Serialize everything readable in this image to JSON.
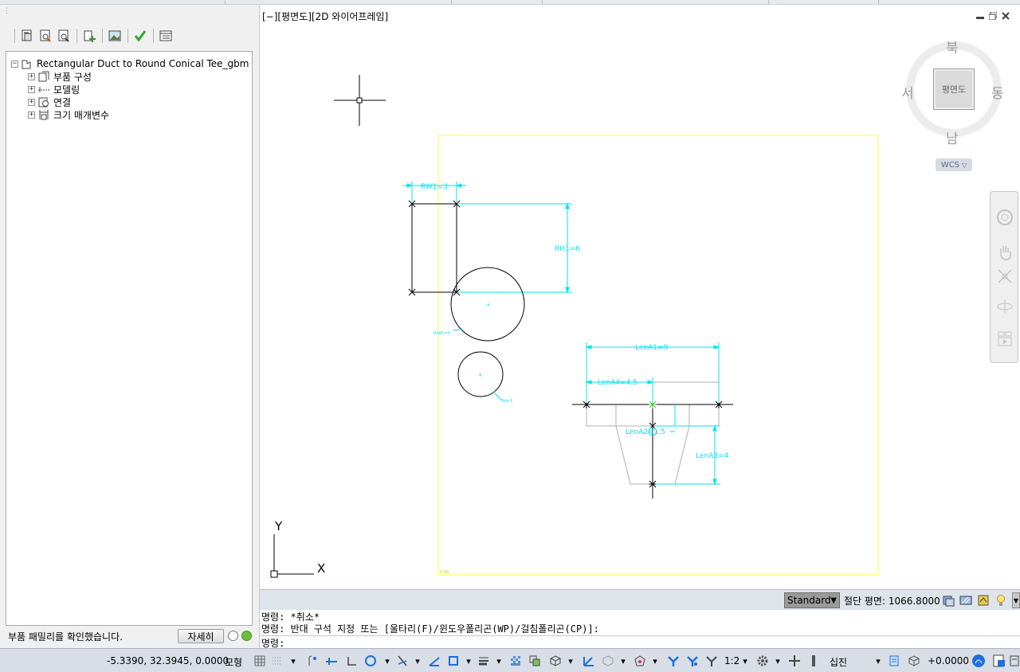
{
  "viewport": {
    "label": "[−][평면도][2D 와이어프레임]",
    "compass": {
      "north": "북",
      "south": "남",
      "east": "동",
      "west": "서"
    },
    "cube_face": "평면도",
    "wcs": "WCS",
    "ucs": {
      "x": "X",
      "y": "Y"
    }
  },
  "drawing": {
    "dims": {
      "rw1": "RW1=3",
      "rh1": "RH1=6",
      "lena1": "LenA1=9",
      "lena4": "LenA4=4.5",
      "lena2": "LenA2=1.5",
      "lena3": "LenA3=4",
      "small1": "RdA1=5",
      "small2": "Rd=3",
      "corner": "0.50"
    }
  },
  "left_panel": {
    "toolbar_icons": [
      "family-properties-icon",
      "edit-params-icon",
      "check-params-icon",
      "add-part-icon",
      "image-icon",
      "validate-check-icon",
      "table-icon"
    ],
    "tree": {
      "root": "Rectangular Duct to Round Conical Tee_gbm",
      "children": [
        {
          "label": "부품 구성",
          "icon": "part-config-icon"
        },
        {
          "label": "모델링",
          "icon": "modeling-icon"
        },
        {
          "label": "연결",
          "icon": "connection-icon"
        },
        {
          "label": "크기 매개변수",
          "icon": "size-params-icon"
        }
      ]
    },
    "status": "부품 패밀리를 확인했습니다.",
    "detail_button": "자세히",
    "status_color": "#6abf3c"
  },
  "viewport_status": {
    "style": "Standard",
    "cut_plane": "절단 평면: 1066.8000"
  },
  "command": {
    "lines": [
      "명령: *취소*",
      "명령: 반대 구석 지정 또는 [울타리(F)/윈도우폴리곤(WP)/걸침폴리곤(CP)]:",
      "명령:"
    ]
  },
  "statusbar": {
    "coords": "-5.3390, 32.3945, 0.0000",
    "model": "모형",
    "scale": "1:2",
    "workspace": "십진",
    "elevation": "+0.0000"
  },
  "colors": {
    "dimension": "#00e5ee",
    "frame": "#ffff33",
    "geometry": "#000000",
    "hidden": "#b0b0b0"
  }
}
